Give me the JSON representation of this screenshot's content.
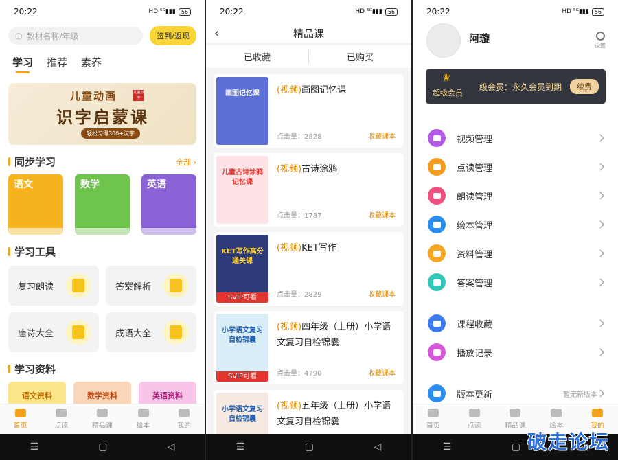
{
  "status": {
    "time": "20:22",
    "signal": "HD ⁵ᴳ▮▮▮",
    "battery": "56"
  },
  "screen1": {
    "search_placeholder": "教材名称/年级",
    "sign_button": "签到/返现",
    "top_tabs": [
      "学习",
      "推荐",
      "素养"
    ],
    "banner": {
      "line1": "儿童动画",
      "line2": "识字启蒙课",
      "line3": "轻松习得300+汉字",
      "seal": "儿童识字"
    },
    "sync_title": "同步学习",
    "sync_more": "全部",
    "books": [
      {
        "label": "语文",
        "color": "#f6b31d"
      },
      {
        "label": "数学",
        "color": "#6fc44d"
      },
      {
        "label": "英语",
        "color": "#8b62d6"
      }
    ],
    "tools_title": "学习工具",
    "tools": [
      "复习朗读",
      "答案解析",
      "唐诗大全",
      "成语大全"
    ],
    "materials_title": "学习资料",
    "materials": [
      {
        "label": "语文资料",
        "color": "#fde58a",
        "text": "#c07000"
      },
      {
        "label": "数学资料",
        "color": "#fbd5b7",
        "text": "#c04a10"
      },
      {
        "label": "英语资料",
        "color": "#f8c5e8",
        "text": "#b02080"
      }
    ]
  },
  "tabbar": [
    "首页",
    "点读",
    "精品课",
    "绘本",
    "我的"
  ],
  "screen2": {
    "title": "精品课",
    "segments": [
      "已收藏",
      "已购买"
    ],
    "courses": [
      {
        "tag": "(视频)",
        "title": "画图记忆课",
        "clicks": "点击量：2828",
        "fav": "收藏课本",
        "thumb": "画图记忆课",
        "thumb_bg": "#5b6fd6",
        "svip": ""
      },
      {
        "tag": "(视频)",
        "title": "古诗涂鸦",
        "clicks": "点击量：1787",
        "fav": "收藏课本",
        "thumb": "儿童古诗涂鸦记忆课",
        "thumb_bg": "#fde2e6",
        "svip": ""
      },
      {
        "tag": "(视频)",
        "title": "KET写作",
        "clicks": "点击量：2829",
        "fav": "收藏课本",
        "thumb": "KET写作高分通关课",
        "thumb_bg": "#2f3c7a",
        "svip": "SVIP可看"
      },
      {
        "tag": "(视频)",
        "title": "四年级（上册）小学语文复习自检锦囊",
        "clicks": "点击量：4790",
        "fav": "收藏课本",
        "thumb": "小学语文复习自检锦囊",
        "thumb_bg": "#d9eef7",
        "svip": "SVIP可看"
      },
      {
        "tag": "(视频)",
        "title": "五年级（上册）小学语文复习自检锦囊",
        "clicks": "",
        "fav": "",
        "thumb": "小学语文复习自检锦囊",
        "thumb_bg": "#f6e9e2",
        "svip": ""
      }
    ]
  },
  "screen3": {
    "username": "阿璇",
    "settings": "设置",
    "vip_label": "超级会员",
    "vip_text": "级会员：永久会员到期",
    "renew": "续费",
    "menu": [
      {
        "label": "视频管理",
        "color": "#b35ae6",
        "note": ""
      },
      {
        "label": "点读管理",
        "color": "#f39a1f",
        "note": ""
      },
      {
        "label": "朗读管理",
        "color": "#f0507e",
        "note": ""
      },
      {
        "label": "绘本管理",
        "color": "#2a8ef0",
        "note": ""
      },
      {
        "label": "资料管理",
        "color": "#f5a623",
        "note": ""
      },
      {
        "label": "答案管理",
        "color": "#34c7b8",
        "note": ""
      }
    ],
    "menu2": [
      {
        "label": "课程收藏",
        "color": "#3d7cf0",
        "note": ""
      },
      {
        "label": "播放记录",
        "color": "#d558d9",
        "note": ""
      }
    ],
    "menu3": [
      {
        "label": "版本更新",
        "color": "#2a8ef0",
        "note": "暂无新版本"
      }
    ]
  },
  "watermark": "破走论坛"
}
